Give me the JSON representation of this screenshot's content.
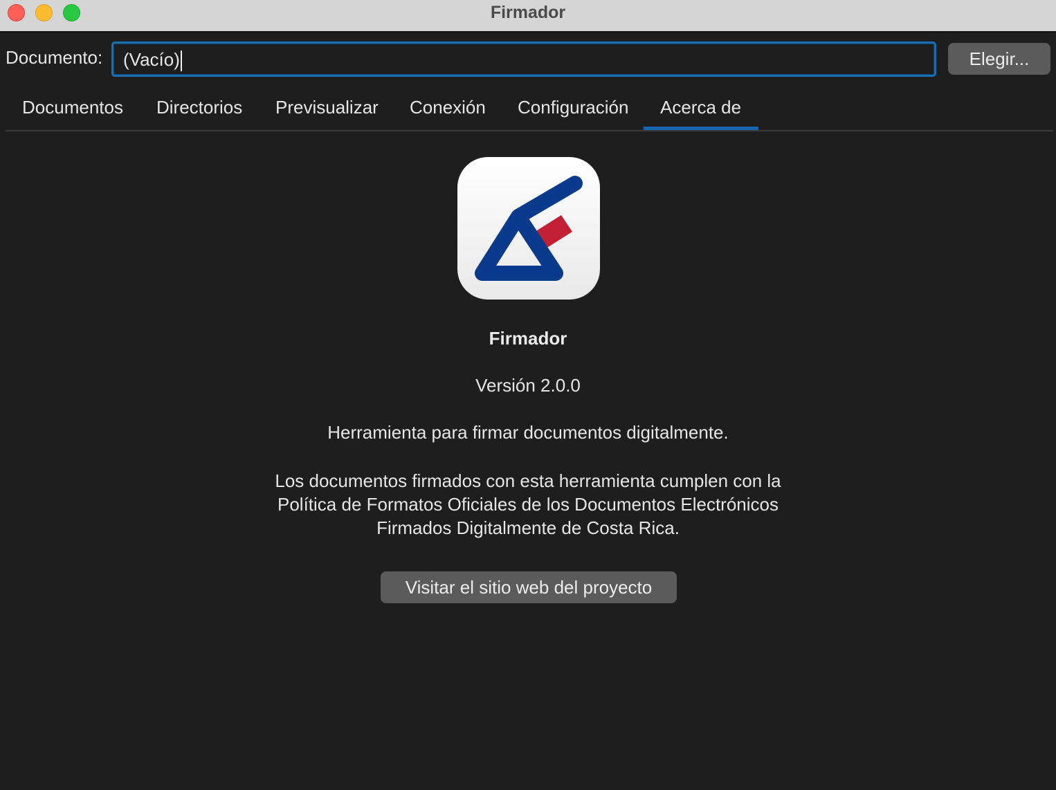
{
  "window": {
    "title": "Firmador"
  },
  "document_row": {
    "label": "Documento:",
    "value": "(Vacío)",
    "choose_button": "Elegir..."
  },
  "tabs": [
    {
      "label": "Documentos",
      "selected": false
    },
    {
      "label": "Directorios",
      "selected": false
    },
    {
      "label": "Previsualizar",
      "selected": false
    },
    {
      "label": "Conexión",
      "selected": false
    },
    {
      "label": "Configuración",
      "selected": false
    },
    {
      "label": "Acerca de",
      "selected": true
    }
  ],
  "about": {
    "app_name": "Firmador",
    "version": "Versión 2.0.0",
    "description": "Herramienta para firmar documentos digitalmente.",
    "policy_lines": [
      "Los documentos firmados con esta herramienta cumplen con la",
      "Política de Formatos Oficiales de los Documentos Electrónicos",
      "Firmados Digitalmente de Costa Rica."
    ],
    "visit_button": "Visitar el sitio web del proyecto",
    "icon": "firmador-logo"
  },
  "colors": {
    "background": "#1e1e1e",
    "accent": "#1764b0",
    "button": "#5b5b5b",
    "logo_blue": "#0a3a8c",
    "logo_red": "#c21f35"
  }
}
